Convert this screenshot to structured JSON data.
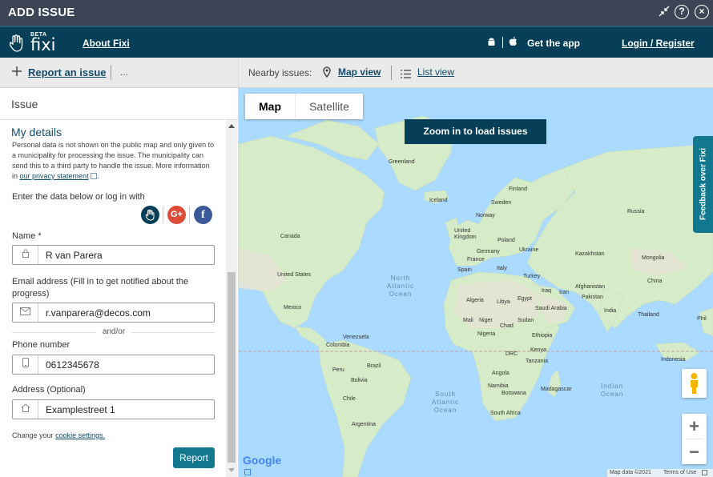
{
  "window": {
    "title": "ADD ISSUE"
  },
  "header": {
    "logo_badge": "BETA",
    "logo_text": "fixi",
    "about": "About Fixi",
    "get_app": "Get the app",
    "login": "Login / Register"
  },
  "toolbar": {
    "report": "Report an issue",
    "more": "..."
  },
  "form": {
    "issue_section": "Issue",
    "my_details": "My details",
    "privacy_text": "Personal data is not shown on the public map and only given to a municipality for processing the issue. The municipality can send this to a third party to handle the issue. More information in",
    "privacy_link": "our privacy statement",
    "enter_data": "Enter the data below or log in with",
    "name_label": "Name *",
    "name_value": "R van Parera",
    "email_label": "Email address (Fill in to get notified about the progress)",
    "email_value": "r.vanparera@decos.com",
    "andor": "and/or",
    "phone_label": "Phone number",
    "phone_value": "0612345678",
    "address_label": "Address (Optional)",
    "address_value": "Examplestreet 1",
    "cookie_prefix": "Change your",
    "cookie_link": "cookie settings.",
    "report_button": "Report"
  },
  "nearby": {
    "label": "Nearby issues:",
    "map_view": "Map view",
    "list_view": "List view"
  },
  "map": {
    "tab_map": "Map",
    "tab_satellite": "Satellite",
    "zoom_banner": "Zoom in to load issues",
    "feedback_tab": "Feedback over Fixi",
    "zoom_in": "+",
    "zoom_out": "−",
    "google": "Google",
    "map_data": "Map data ©2021",
    "terms": "Terms of Use",
    "labels": {
      "greenland": "Greenland",
      "iceland": "Iceland",
      "finland": "Finland",
      "sweden": "Sweden",
      "norway": "Norway",
      "russia": "Russia",
      "uk": "United Kingdom",
      "poland": "Poland",
      "germany": "Germany",
      "ukraine": "Ukraine",
      "france": "France",
      "spain": "Spain",
      "italy": "Italy",
      "kazakhstan": "Kazakhstan",
      "mongolia": "Mongolia",
      "china": "China",
      "canada": "Canada",
      "us": "United States",
      "mexico": "Mexico",
      "north_atlantic": "North Atlantic Ocean",
      "turkey": "Turkey",
      "iraq": "Iraq",
      "iran": "Iran",
      "afghanistan": "Afghanistan",
      "pakistan": "Pakistan",
      "india": "India",
      "algeria": "Algeria",
      "libya": "Libya",
      "egypt": "Egypt",
      "saudi": "Saudi Arabia",
      "mali": "Mali",
      "niger": "Niger",
      "chad": "Chad",
      "sudan": "Sudan",
      "nigeria": "Nigeria",
      "ethiopia": "Ethiopia",
      "drc": "DRC",
      "kenya": "Kenya",
      "tanzania": "Tanzania",
      "angola": "Angola",
      "namibia": "Namibia",
      "botswana": "Botswana",
      "madagascar": "Madagascar",
      "south_africa": "South Africa",
      "venezuela": "Venezuela",
      "colombia": "Colombia",
      "peru": "Peru",
      "brazil": "Brazil",
      "bolivia": "Bolivia",
      "chile": "Chile",
      "argentina": "Argentina",
      "south_atlantic": "South Atlantic Ocean",
      "indian_ocean": "Indian Ocean",
      "indonesia": "Indonesia",
      "thailand": "Thailand",
      "phil": "Phil"
    }
  },
  "colors": {
    "titlebar": "#3b4555",
    "header": "#063f57",
    "report_button": "#11788f",
    "link": "#124b6a",
    "ocean": "#aadaff",
    "land": "#d4ecc4"
  }
}
